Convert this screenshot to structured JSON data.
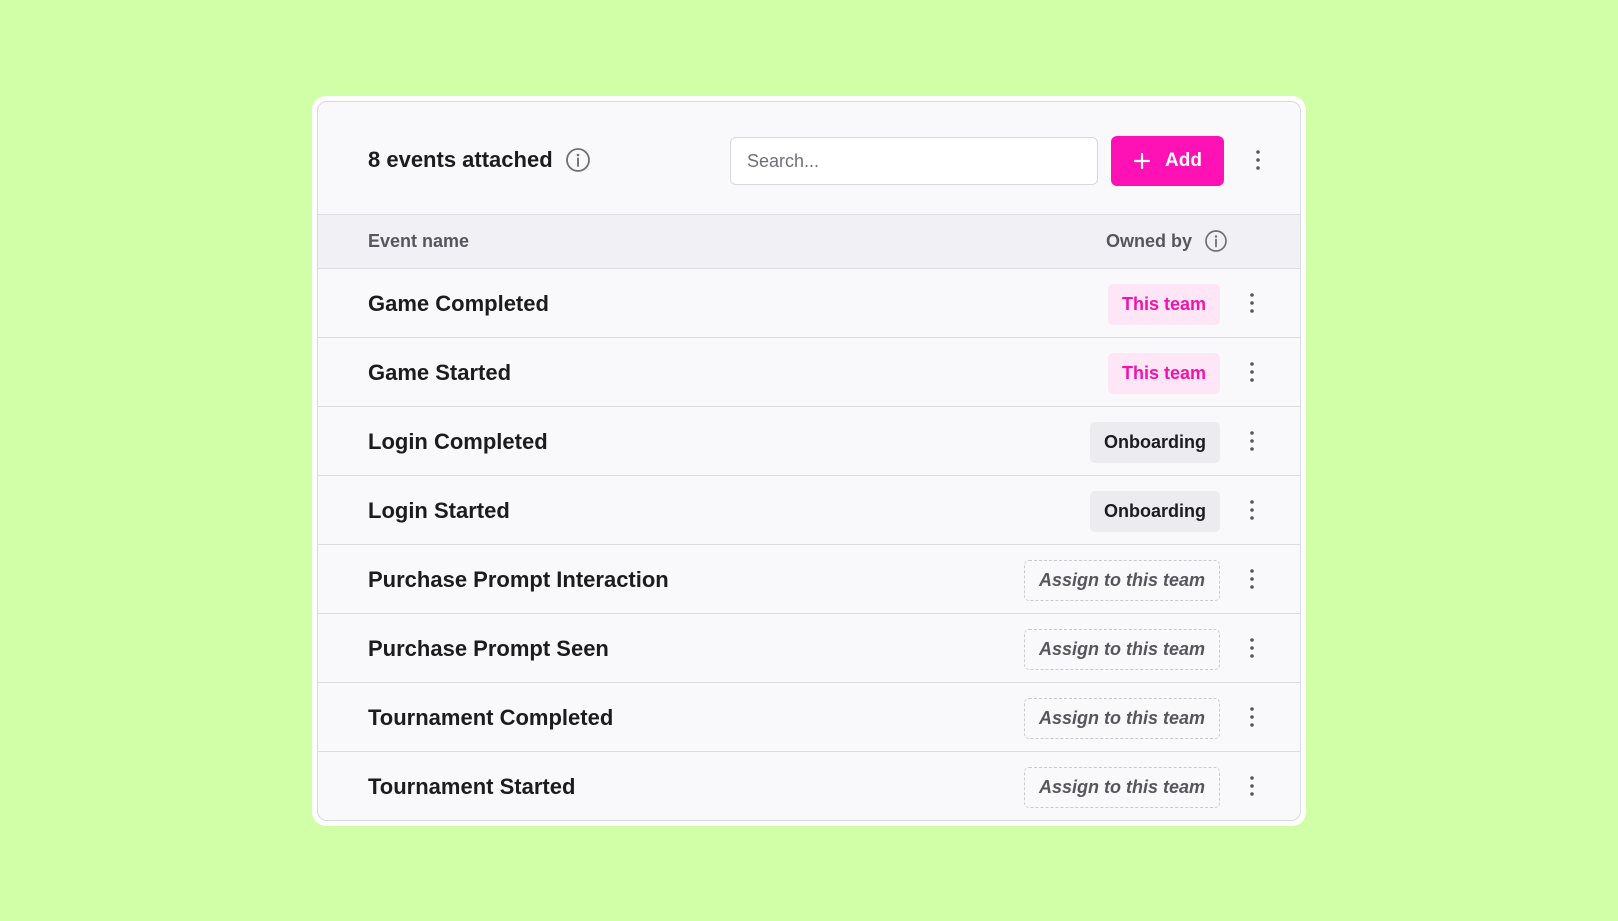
{
  "header": {
    "title": "8 events attached",
    "search_placeholder": "Search...",
    "add_label": "Add"
  },
  "columns": {
    "event_name": "Event name",
    "owned_by": "Owned by"
  },
  "rows": [
    {
      "name": "Game Completed",
      "owner": "This team",
      "owner_type": "team"
    },
    {
      "name": "Game Started",
      "owner": "This team",
      "owner_type": "team"
    },
    {
      "name": "Login Completed",
      "owner": "Onboarding",
      "owner_type": "other"
    },
    {
      "name": "Login Started",
      "owner": "Onboarding",
      "owner_type": "other"
    },
    {
      "name": "Purchase Prompt Interaction",
      "owner": "Assign to this team",
      "owner_type": "unassigned"
    },
    {
      "name": "Purchase Prompt Seen",
      "owner": "Assign to this team",
      "owner_type": "unassigned"
    },
    {
      "name": "Tournament Completed",
      "owner": "Assign to this team",
      "owner_type": "unassigned"
    },
    {
      "name": "Tournament Started",
      "owner": "Assign to this team",
      "owner_type": "unassigned"
    }
  ],
  "colors": {
    "background": "#d1ffa8",
    "accent": "#ff12b5",
    "team_badge_bg": "#ffe6f6"
  },
  "icons": [
    "info-icon",
    "plus-icon",
    "more-vertical-icon"
  ]
}
